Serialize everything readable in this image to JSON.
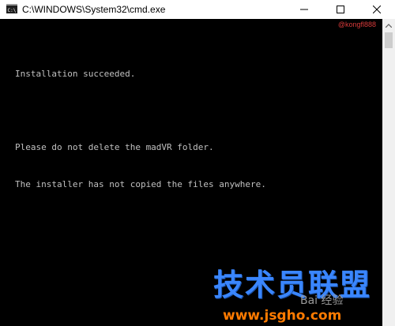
{
  "window": {
    "title": "C:\\WINDOWS\\System32\\cmd.exe",
    "app_icon": "cmd-console-icon",
    "controls": {
      "minimize_icon": "minimize-icon",
      "maximize_icon": "maximize-icon",
      "close_icon": "close-icon"
    }
  },
  "console": {
    "background": "#000000",
    "text_color": "#c0c0c0",
    "lines": [
      "Installation succeeded.",
      "",
      "Please do not delete the madVR folder.",
      "The installer has not copied the files anywhere."
    ]
  },
  "watermarks": {
    "top_right": "@kongfl888",
    "logo_chinese": "技术员联盟",
    "logo_sub": "Bai  经验",
    "logo_url": "www.jsgho.com"
  },
  "scrollbar": {
    "up_icon": "scroll-up-arrow-icon"
  }
}
